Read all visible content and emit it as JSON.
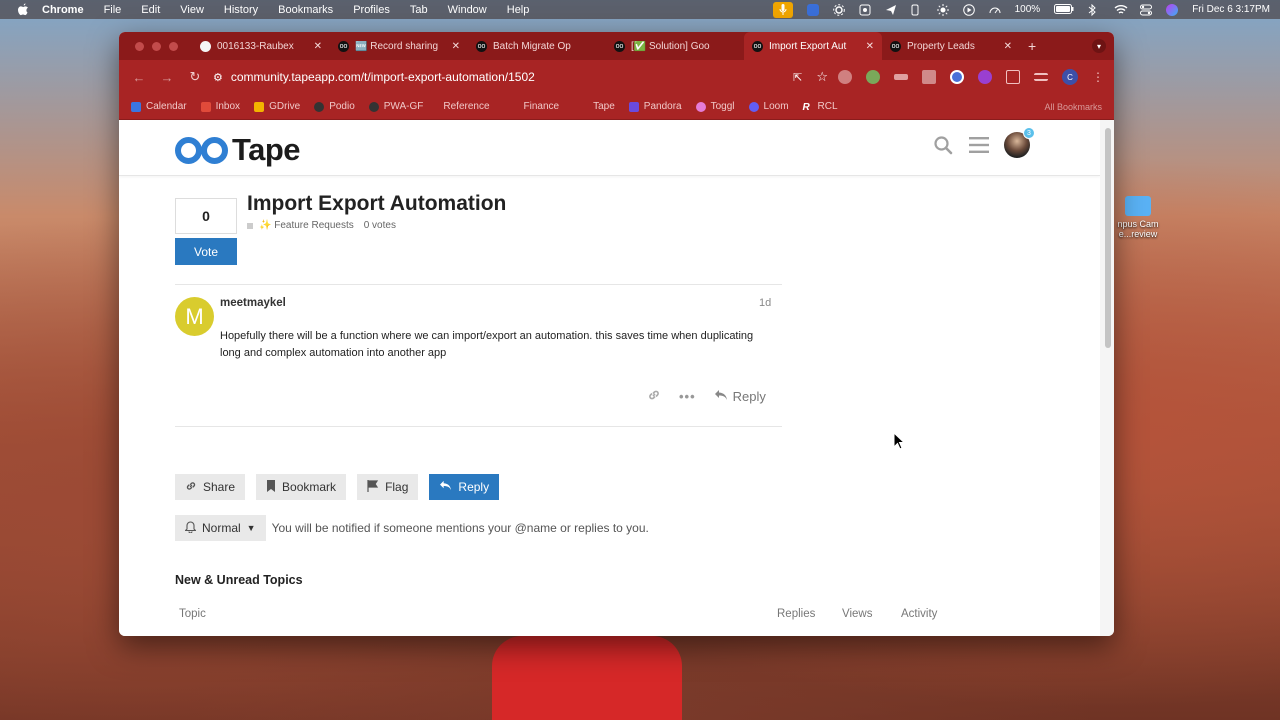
{
  "menubar": {
    "app": "Chrome",
    "items": [
      "File",
      "Edit",
      "View",
      "History",
      "Bookmarks",
      "Profiles",
      "Tab",
      "Window",
      "Help"
    ],
    "battery": "100%",
    "datetime": "Fri Dec 6  3:17PM"
  },
  "desktop": {
    "icon_label_1": "npus Cam",
    "icon_label_2": "e...review"
  },
  "browser": {
    "tabs": [
      {
        "label": "0016133-Raubex",
        "active": false
      },
      {
        "label": "🆕 Record sharing",
        "active": false
      },
      {
        "label": "Batch Migrate Op",
        "active": false
      },
      {
        "label": "[✅ Solution] Goo",
        "active": false
      },
      {
        "label": "Import Export Aut",
        "active": true
      },
      {
        "label": "Property Leads",
        "active": false
      }
    ],
    "url": "community.tapeapp.com/t/import-export-automation/1502",
    "bookmarks": [
      {
        "label": "Calendar"
      },
      {
        "label": "Inbox"
      },
      {
        "label": "GDrive"
      },
      {
        "label": "Podio"
      },
      {
        "label": "PWA-GF"
      },
      {
        "label": "Reference"
      },
      {
        "label": "Finance"
      },
      {
        "label": "Tape"
      },
      {
        "label": "Pandora"
      },
      {
        "label": "Toggl"
      },
      {
        "label": "Loom"
      },
      {
        "label": "RCL"
      }
    ],
    "all_bookmarks": "All Bookmarks",
    "profile_initial": "C"
  },
  "site": {
    "logo_text": "Tape",
    "notification_count": "3"
  },
  "topic": {
    "vote_count": "0",
    "vote_label": "Vote",
    "title": "Import Export Automation",
    "category": "✨ Feature Requests",
    "votes": "0 votes"
  },
  "post": {
    "avatar_letter": "M",
    "author": "meetmaykel",
    "date": "1d",
    "body": "Hopefully there will be a function where we can import/export an automation. this saves time when duplicating long and complex automation into another app",
    "reply_label": "Reply"
  },
  "actions": {
    "share": "Share",
    "bookmark": "Bookmark",
    "flag": "Flag",
    "reply": "Reply"
  },
  "notifications": {
    "level": "Normal",
    "description": "You will be notified if someone mentions your @name or replies to you."
  },
  "topics_list": {
    "title": "New & Unread Topics",
    "columns": {
      "topic": "Topic",
      "replies": "Replies",
      "views": "Views",
      "activity": "Activity"
    }
  },
  "colors": {
    "browser_theme": "#a82424",
    "brand_blue": "#2a79c0",
    "avatar_yellow": "#d9cc2e"
  }
}
